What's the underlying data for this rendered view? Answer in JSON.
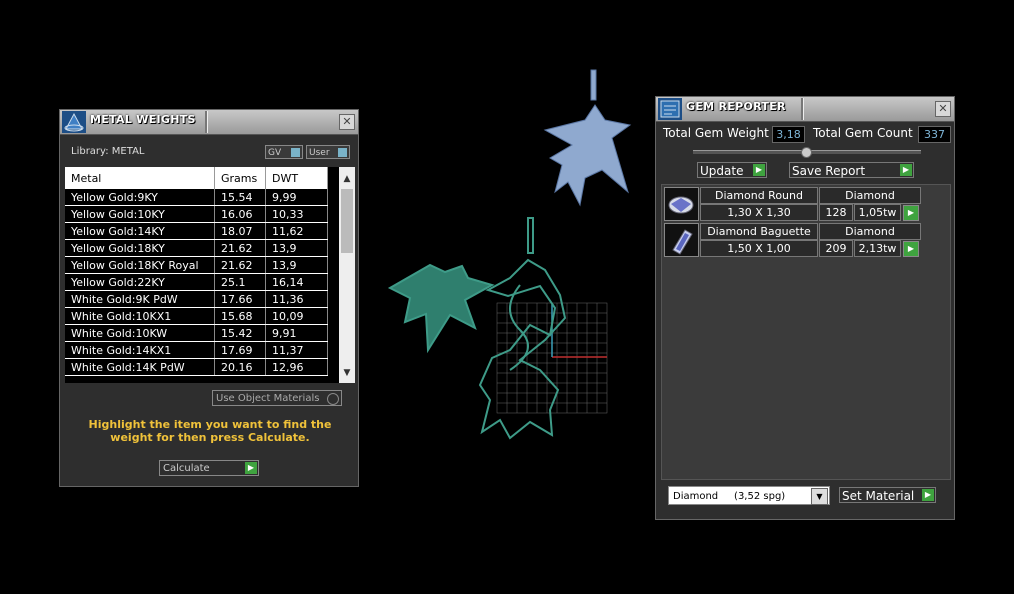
{
  "metal_weights": {
    "title": "METAL WEIGHTS",
    "library_label": "Library: METAL",
    "toggle_gv": "GV",
    "toggle_user": "User",
    "columns": [
      "Metal",
      "Grams",
      "DWT"
    ],
    "rows": [
      [
        "Yellow Gold:9KY",
        "15.54",
        "9,99"
      ],
      [
        "Yellow Gold:10KY",
        "16.06",
        "10,33"
      ],
      [
        "Yellow Gold:14KY",
        "18.07",
        "11,62"
      ],
      [
        "Yellow Gold:18KY",
        "21.62",
        "13,9"
      ],
      [
        "Yellow Gold:18KY Royal",
        "21.62",
        "13,9"
      ],
      [
        "Yellow Gold:22KY",
        "25.1",
        "16,14"
      ],
      [
        "White Gold:9K PdW",
        "17.66",
        "11,36"
      ],
      [
        "White Gold:10KX1",
        "15.68",
        "10,09"
      ],
      [
        "White Gold:10KW",
        "15.42",
        "9,91"
      ],
      [
        "White Gold:14KX1",
        "17.69",
        "11,37"
      ],
      [
        "White Gold:14K PdW",
        "20.16",
        "12,96"
      ]
    ],
    "use_object_materials": "Use Object Materials",
    "hint": "Highlight the item you want to find the weight for then press Calculate.",
    "calculate_label": "Calculate",
    "hint_color": "#f0c23a"
  },
  "gem_reporter": {
    "title": "GEM REPORTER",
    "total_gem_weight_label": "Total Gem Weight",
    "total_gem_weight": "3,18",
    "total_gem_count_label": "Total Gem Count",
    "total_gem_count": "337",
    "update_label": "Update",
    "save_report_label": "Save Report",
    "gems": [
      {
        "name": "Diamond Round",
        "material": "Diamond",
        "size": "1,30 X 1,30",
        "count": "128",
        "weight": "1,05tw"
      },
      {
        "name": "Diamond Baguette",
        "material": "Diamond",
        "size": "1,50 X 1,00",
        "count": "209",
        "weight": "2,13tw"
      }
    ],
    "material_select": "Diamond     (3,52 spg)",
    "set_material_label": "Set Material"
  },
  "colors": {
    "accent_green": "#3fa33f",
    "value_blue": "#7fb6d8"
  }
}
